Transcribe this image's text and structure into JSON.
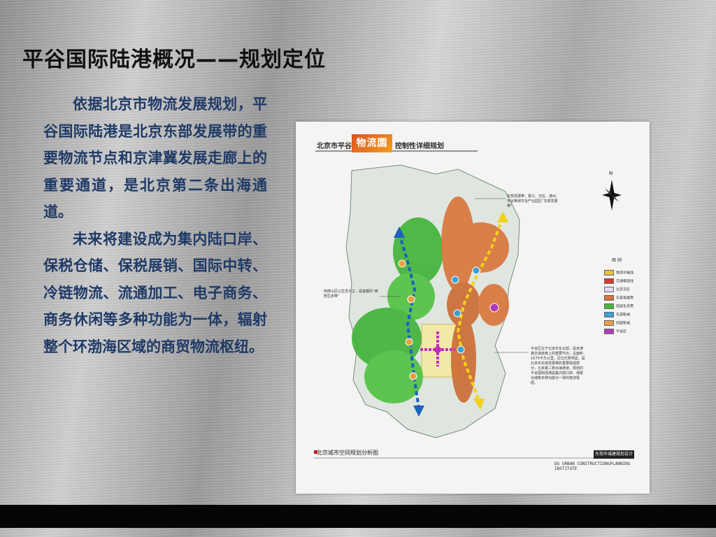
{
  "slide": {
    "title": "平谷国际陆港概况——规划定位",
    "paragraphs": [
      "依据北京市物流发展规划，平谷国际陆港是北京东部发展带的重要物流节点和京津冀发展走廊上的重要通道，是北京第二条出海通道。",
      "未来将建设成为集内陆口岸、保税仓储、保税展销、国际中转、冷链物流、流通加工、电子商务、商务休闲等多种功能为一体，辐射整个环渤海区域的商贸物流枢纽。"
    ]
  },
  "figure": {
    "header_left": "北京市平谷",
    "header_logo": "物流園",
    "header_right": "控制性详细规划",
    "caption": "北京城市空间规划分析图",
    "institute_cn": "东莞市城建规划设计院",
    "institute_en": "DG URBAN CONSTRUCTION&PLANNING INSTITUTE",
    "compass_label": "N",
    "legend_title": "图 例",
    "legend": [
      {
        "label": "物流中轴线",
        "color": "#e8c23a"
      },
      {
        "label": "交通枢纽线",
        "color": "#d93a2a"
      },
      {
        "label": "北京市区",
        "color": "#e3d8f0"
      },
      {
        "label": "东部发展带",
        "color": "#d9743a"
      },
      {
        "label": "西部生态带",
        "color": "#49b53c"
      },
      {
        "label": "东部新城",
        "color": "#3aa0d8"
      },
      {
        "label": "西部新城",
        "color": "#e8a040"
      },
      {
        "label": "平谷区",
        "color": "#b03ab0"
      }
    ],
    "annotations": {
      "top_right": "东部发展带：顺义、亦庄、通州、平谷等城市及产业园区“东部发展带”",
      "left_mid": "西部山区以生态为主，是首都的“西部生态带”",
      "right_lower": "平谷区位于北京市东北部，是京津冀交通走廊上的重要节点，总面积1075平方公里。区位优势明显，是北京市东部发展带的重要组成部分，北京第二条出海通道，规划的平谷国际陆港是集内陆口岸、保税仓储等多种功能为一体的物流枢纽。"
    }
  }
}
